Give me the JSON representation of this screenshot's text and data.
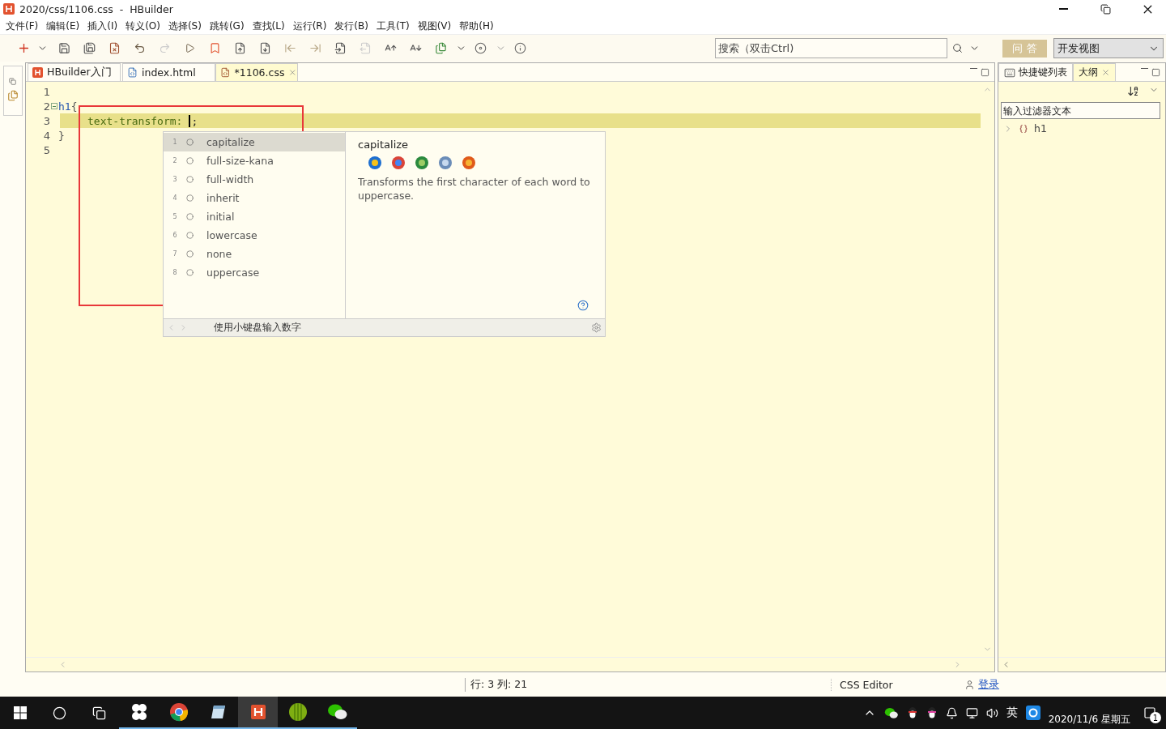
{
  "window": {
    "title": "2020/css/1106.css  -  HBuilder"
  },
  "menu": [
    "文件(F)",
    "编辑(E)",
    "插入(I)",
    "转义(O)",
    "选择(S)",
    "跳转(G)",
    "查找(L)",
    "运行(R)",
    "发行(B)",
    "工具(T)",
    "视图(V)",
    "帮助(H)"
  ],
  "toolbar": {
    "search": {
      "placeholder": "搜索（双击Ctrl)"
    },
    "qa_button": "问 答",
    "view_select": "开发视图"
  },
  "editor_tabs": [
    {
      "label": "HBuilder入门",
      "kind": "hbuilder",
      "selected": false
    },
    {
      "label": "index.html",
      "kind": "html",
      "selected": false
    },
    {
      "label": "*1106.css",
      "kind": "css",
      "selected": true
    }
  ],
  "code_lines": [
    {
      "number": "1",
      "current": false
    },
    {
      "number": "2",
      "current": false,
      "tokens": [
        {
          "text": "h1",
          "kind": "selector"
        },
        {
          "text": "{",
          "kind": "brace"
        }
      ]
    },
    {
      "number": "3",
      "current": true,
      "tokens": [
        {
          "text": "text-transform:",
          "kind": "property"
        },
        {
          "text": ";",
          "kind": "punct"
        }
      ]
    },
    {
      "number": "4",
      "current": false,
      "tokens": [
        {
          "text": "}",
          "kind": "brace"
        }
      ]
    },
    {
      "number": "5",
      "current": false
    }
  ],
  "autocomplete": {
    "items": [
      {
        "index": "1",
        "label": "capitalize",
        "selected": true
      },
      {
        "index": "2",
        "label": "full-size-kana",
        "selected": false
      },
      {
        "index": "3",
        "label": "full-width",
        "selected": false
      },
      {
        "index": "4",
        "label": "inherit",
        "selected": false
      },
      {
        "index": "5",
        "label": "initial",
        "selected": false
      },
      {
        "index": "6",
        "label": "lowercase",
        "selected": false
      },
      {
        "index": "7",
        "label": "none",
        "selected": false
      },
      {
        "index": "8",
        "label": "uppercase",
        "selected": false
      }
    ],
    "detail": {
      "title": "capitalize",
      "description": "Transforms the first character of each word to uppercase."
    },
    "footer": "使用小键盘输入数字"
  },
  "outline": {
    "tabs": [
      {
        "label": "快捷键列表",
        "selected": false
      },
      {
        "label": "大纲",
        "selected": true
      }
    ],
    "filter": {
      "placeholder": "输入过滤器文本"
    },
    "items": [
      {
        "label": "h1",
        "expanded": false
      }
    ]
  },
  "status_bar": {
    "position": "行: 3 列: 21",
    "editor_type": "CSS Editor",
    "login": "登录"
  },
  "taskbar": {
    "apps": [
      {
        "kind": "pinwheel",
        "selected": false
      },
      {
        "kind": "chrome",
        "selected": false
      },
      {
        "kind": "notepad",
        "selected": false
      },
      {
        "kind": "hbuilder",
        "selected": true
      },
      {
        "kind": "ball",
        "selected": false
      },
      {
        "kind": "wechat",
        "selected": false
      }
    ],
    "ime": "英",
    "date": "2020/11/6 星期五",
    "notification_count": "1"
  }
}
